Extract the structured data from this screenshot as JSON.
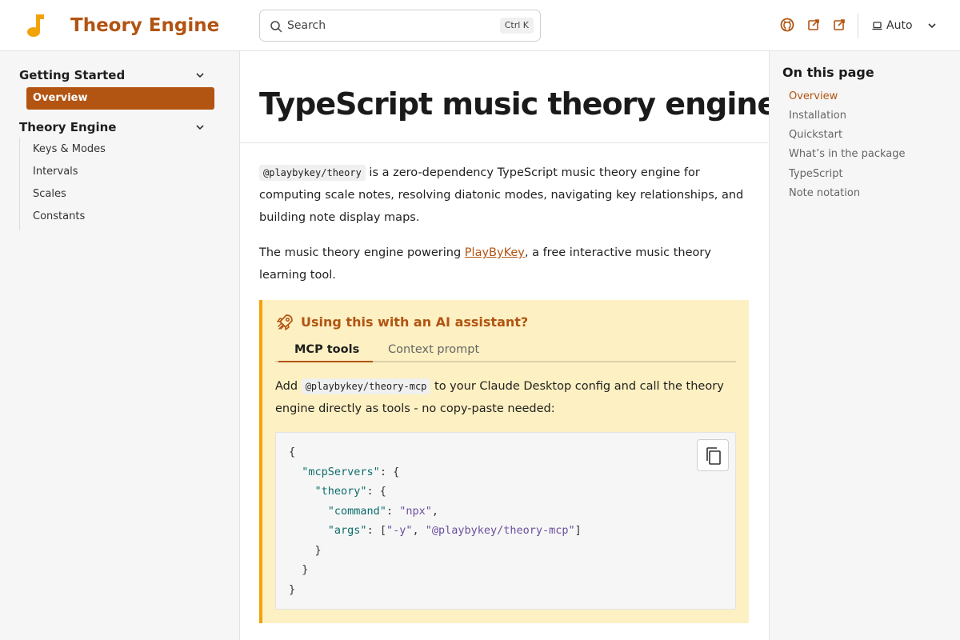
{
  "header": {
    "brand": "Theory Engine",
    "search_placeholder": "Search",
    "search_shortcut": "Ctrl K",
    "theme_label": "Auto"
  },
  "sidebar": {
    "groups": [
      {
        "title": "Getting Started",
        "items": [
          "Overview"
        ]
      },
      {
        "title": "Theory Engine",
        "items": [
          "Keys & Modes",
          "Intervals",
          "Scales",
          "Constants"
        ]
      }
    ],
    "active_item": "Overview"
  },
  "main": {
    "title": "TypeScript music theory engine",
    "intro_code": "@playbykey/theory",
    "intro_text": " is a zero-dependency TypeScript music theory engine for computing scale notes, resolving diatonic modes, navigating key relationships, and building note display maps.",
    "powering_text_before": "The music theory engine powering ",
    "powering_link": "PlayByKey",
    "powering_text_after": ", a free interactive music theory learning tool.",
    "callout": {
      "title": "Using this with an AI assistant?",
      "tabs": [
        "MCP tools",
        "Context prompt"
      ],
      "active_tab": "MCP tools",
      "text_before": "Add ",
      "text_code": "@playbykey/theory-mcp",
      "text_after": " to your Claude Desktop config and call the theory engine directly as tools - no copy-paste needed:",
      "code": {
        "mcp_key": "\"mcpServers\"",
        "theory_key": "\"theory\"",
        "command_key": "\"command\"",
        "command_val": "\"npx\"",
        "args_key": "\"args\"",
        "arg1": "\"-y\"",
        "arg2": "\"@playbykey/theory-mcp\""
      }
    }
  },
  "toc": {
    "title": "On this page",
    "items": [
      "Overview",
      "Installation",
      "Quickstart",
      "What’s in the package",
      "TypeScript",
      "Note notation"
    ],
    "active": "Overview"
  },
  "colors": {
    "accent": "#b25412",
    "callout_bg": "#fdf0c2",
    "callout_border": "#f2a20a"
  }
}
